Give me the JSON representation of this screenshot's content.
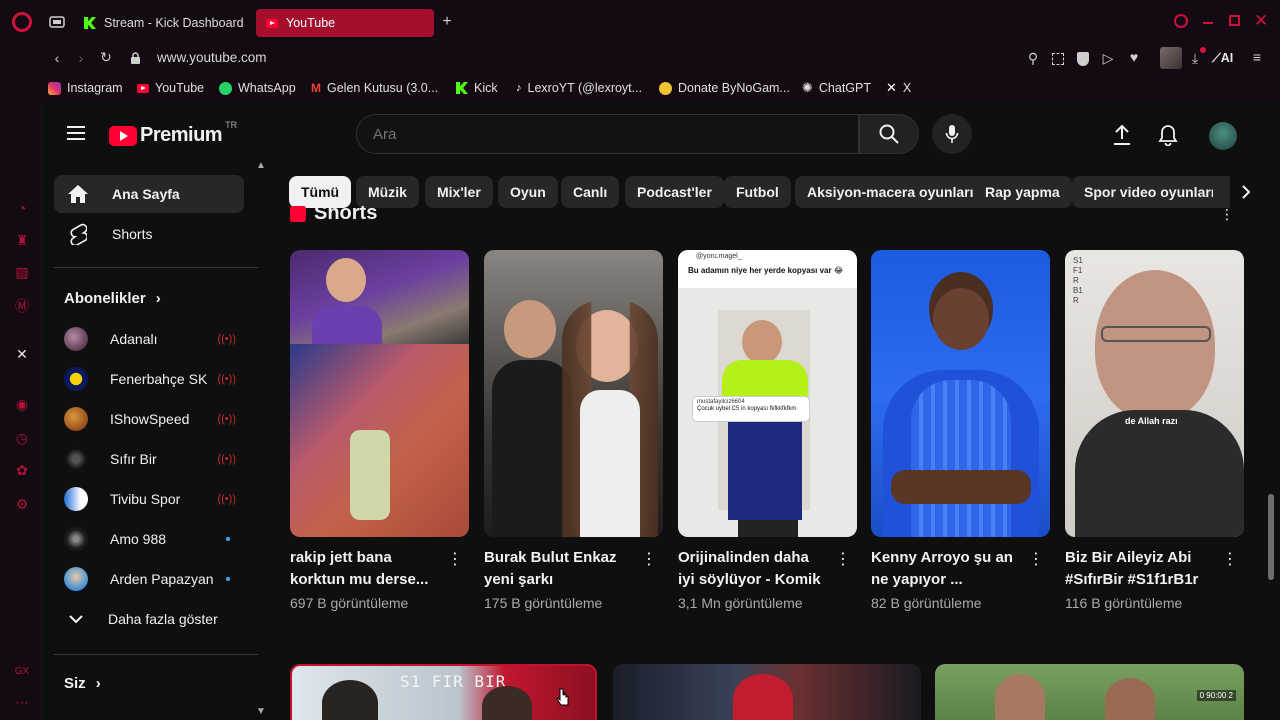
{
  "browser": {
    "tabs": [
      {
        "title": "Stream - Kick Dashboard",
        "active": false
      },
      {
        "title": "YouTube",
        "active": true
      }
    ],
    "url": "www.youtube.com",
    "bookmarks": [
      "Instagram",
      "YouTube",
      "WhatsApp",
      "Gelen Kutusu (3.0...",
      "Kick",
      "LexroYT (@lexroyt...",
      "Donate ByNoGam...",
      "ChatGPT",
      "X"
    ],
    "ai_label": "AI"
  },
  "youtube": {
    "logo_text": "Premium",
    "logo_superscript": "TR",
    "search": {
      "placeholder": "Ara"
    },
    "sidebar": {
      "home": "Ana Sayfa",
      "shorts": "Shorts",
      "subscriptions_heading": "Abonelikler",
      "subscriptions": [
        {
          "name": "Adanalı",
          "status": "live"
        },
        {
          "name": "Fenerbahçe SK",
          "status": "live"
        },
        {
          "name": "IShowSpeed",
          "status": "live"
        },
        {
          "name": "Sıfır Bir",
          "status": "live"
        },
        {
          "name": "Tivibu Spor",
          "status": "live"
        },
        {
          "name": "Amo 988",
          "status": "new"
        },
        {
          "name": "Arden Papazyan",
          "status": "new"
        }
      ],
      "show_more": "Daha fazla göster",
      "you_heading": "Siz"
    },
    "chips": [
      "Tümü",
      "Müzik",
      "Mix'ler",
      "Oyun",
      "Canlı",
      "Podcast'ler",
      "Futbol",
      "Aksiyon-macera oyunları",
      "Rap yapma",
      "Spor video oyunları"
    ],
    "shorts_heading": "Shorts",
    "shorts": [
      {
        "title": "rakip jett bana korktun mu derse... ...",
        "views": "697 B görüntüleme"
      },
      {
        "title": "Burak Bulut Enkaz yeni şarkı",
        "views": "175 B görüntüleme"
      },
      {
        "title": "Orijinalinden daha iyi söylüyor - Komik ...",
        "views": "3,1 Mn görüntüleme"
      },
      {
        "title": "Kenny Arroyo şu an ne yapıyor ...",
        "views": "82 B görüntüleme"
      },
      {
        "title": "Biz Bir Aileyiz Abi #SıfırBir #S1f1rB1r ...",
        "views": "116 B görüntüleme"
      }
    ],
    "short_overlays": {
      "third_header": "Bu adamın niye her yerde kopyası var 😂",
      "third_user": "@yoru.magel_",
      "third_comment_user": "mustafayilciz6604",
      "third_comment": "Çocuk uybel C5 in kopyası fkfkkfkfkm",
      "fifth_caption": "de Allah razı",
      "fifth_side": "S1 F1 R B1 R"
    },
    "bottom_thumb_text": "S1 FIR BIR",
    "bottom_score": "0  90:00  2"
  }
}
